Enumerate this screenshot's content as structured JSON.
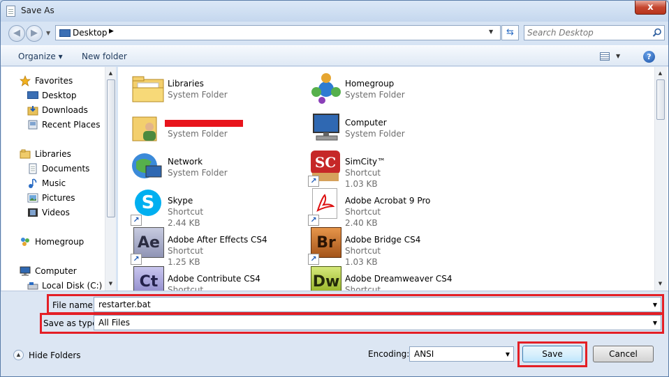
{
  "window": {
    "title": "Save As",
    "close_glyph": "x"
  },
  "address_bar": {
    "location": "Desktop",
    "search_placeholder": "Search Desktop"
  },
  "toolbar": {
    "organize_label": "Organize ▾",
    "new_folder_label": "New folder",
    "help_glyph": "?"
  },
  "nav_pane": {
    "favorites_label": "Favorites",
    "favorites": [
      {
        "label": "Desktop",
        "icon": "desktop-icon"
      },
      {
        "label": "Downloads",
        "icon": "downloads-icon"
      },
      {
        "label": "Recent Places",
        "icon": "recent-places-icon"
      }
    ],
    "libraries_label": "Libraries",
    "libraries": [
      {
        "label": "Documents",
        "icon": "documents-icon"
      },
      {
        "label": "Music",
        "icon": "music-icon"
      },
      {
        "label": "Pictures",
        "icon": "pictures-icon"
      },
      {
        "label": "Videos",
        "icon": "videos-icon"
      }
    ],
    "homegroup_label": "Homegroup",
    "computer_label": "Computer",
    "computer_items": [
      {
        "label": "Local Disk (C:)",
        "icon": "drive-icon"
      }
    ]
  },
  "items": [
    {
      "name": "Libraries",
      "line2": "System Folder",
      "line3": "",
      "icon": "libraries-folder-icon"
    },
    {
      "name": "Homegroup",
      "line2": "System Folder",
      "line3": "",
      "icon": "homegroup-icon"
    },
    {
      "name": "",
      "line2": "System Folder",
      "line3": "",
      "icon": "user-folder-icon",
      "redacted": true
    },
    {
      "name": "Computer",
      "line2": "System Folder",
      "line3": "",
      "icon": "computer-icon"
    },
    {
      "name": "Network",
      "line2": "System Folder",
      "line3": "",
      "icon": "network-icon"
    },
    {
      "name": "SimCity™",
      "line2": "Shortcut",
      "line3": "1.03 KB",
      "icon": "simcity-icon"
    },
    {
      "name": "Skype",
      "line2": "Shortcut",
      "line3": "2.44 KB",
      "icon": "skype-icon"
    },
    {
      "name": "Adobe Acrobat 9 Pro",
      "line2": "Shortcut",
      "line3": "2.40 KB",
      "icon": "acrobat-icon"
    },
    {
      "name": "Adobe After Effects CS4",
      "line2": "Shortcut",
      "line3": "1.25 KB",
      "icon": "after-effects-icon"
    },
    {
      "name": "Adobe Bridge CS4",
      "line2": "Shortcut",
      "line3": "1.03 KB",
      "icon": "bridge-icon"
    },
    {
      "name": "Adobe Contribute CS4",
      "line2": "Shortcut",
      "line3": "",
      "icon": "contribute-icon"
    },
    {
      "name": "Adobe Dreamweaver CS4",
      "line2": "Shortcut",
      "line3": "",
      "icon": "dreamweaver-icon"
    }
  ],
  "icon_letters": {
    "after_effects": "Ae",
    "bridge": "Br",
    "contribute": "Ct",
    "dreamweaver": "Dw",
    "simcity": "SC"
  },
  "form": {
    "file_name_label": "File name:",
    "file_name_value": "restarter.bat",
    "save_type_label": "Save as type:",
    "save_type_value": "All Files",
    "encoding_label": "Encoding:",
    "encoding_value": "ANSI"
  },
  "buttons": {
    "save": "Save",
    "cancel": "Cancel",
    "hide_folders": "Hide Folders"
  },
  "colors": {
    "highlight_box": "#e41f26",
    "redaction": "#e8141c"
  }
}
